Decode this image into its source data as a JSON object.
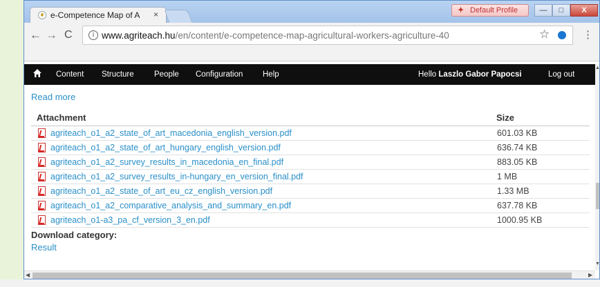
{
  "browser": {
    "tab_title": "e-Competence Map of A",
    "tab_close": "×",
    "profile_label": "Default Profile",
    "window_buttons": {
      "minimize": "—",
      "maximize": "□",
      "close": "X"
    },
    "url_host": "www.agriteach.hu",
    "url_path": "/en/content/e-competence-map-agricultural-workers-agriculture-40",
    "nav": {
      "back": "←",
      "forward": "→",
      "reload": "C"
    },
    "icons": {
      "info": "info-icon",
      "star": "star-icon",
      "menu": "menu-icon"
    }
  },
  "admin_toolbar": {
    "home_icon": "home-icon",
    "items": [
      "Content",
      "Structure",
      "People",
      "Configuration",
      "Help"
    ],
    "hello_prefix": "Hello ",
    "user_name": "Laszlo Gabor Papocsi",
    "logout": "Log out"
  },
  "content": {
    "read_more": "Read more",
    "table": {
      "headers": {
        "attachment": "Attachment",
        "size": "Size"
      },
      "rows": [
        {
          "file": "agriteach_o1_a2_state_of_art_macedonia_english_version.pdf",
          "size": "601.03 KB"
        },
        {
          "file": "agriteach_o1_a2_state_of_art_hungary_english_version.pdf",
          "size": "636.74 KB"
        },
        {
          "file": "agriteach_o1_a2_survey_results_in_macedonia_en_final.pdf",
          "size": "883.05 KB"
        },
        {
          "file": "agriteach_o1_a2_survey_results_in-hungary_en_version_final.pdf",
          "size": "1 MB"
        },
        {
          "file": "agriteach_o1_a2_state_of_art_eu_cz_english_version.pdf",
          "size": "1.33 MB"
        },
        {
          "file": "agriteach_o1_a2_comparative_analysis_and_summary_en.pdf",
          "size": "637.78 KB"
        },
        {
          "file": "agriteach_o1-a3_pa_cf_version_3_en.pdf",
          "size": "1000.95 KB"
        }
      ]
    },
    "download_category_label": "Download category:",
    "download_category_value": "Result"
  },
  "colors": {
    "link": "#2a8fc9",
    "admin_bar": "#0f0f0f",
    "window_border": "#5f8fc9"
  }
}
